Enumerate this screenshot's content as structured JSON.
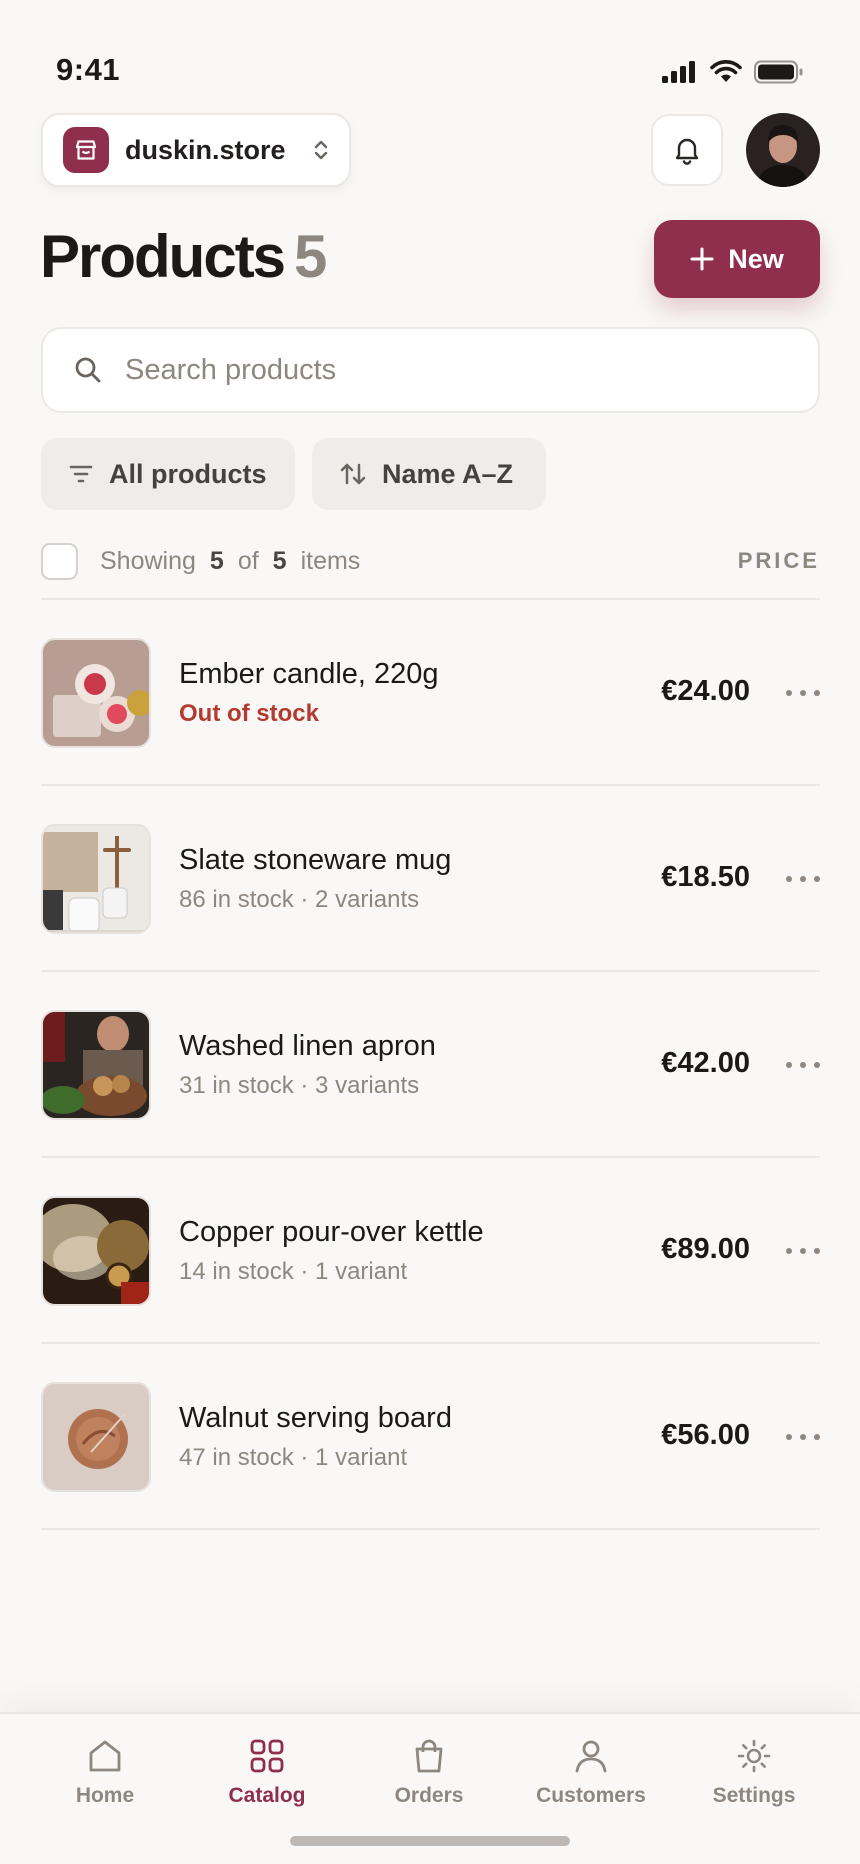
{
  "status_bar": {
    "time": "9:41"
  },
  "store": {
    "name": "duskin.store"
  },
  "header": {
    "title": "Products",
    "count": "5",
    "new_label": "New"
  },
  "search": {
    "placeholder": "Search products"
  },
  "filters": {
    "all_label": "All products",
    "sort_label": "Name A–Z"
  },
  "list_header": {
    "showing": "Showing",
    "shown": "5",
    "of": "of",
    "total": "5",
    "items": "items",
    "price": "PRICE"
  },
  "products": [
    {
      "name": "Ember candle, 220g",
      "meta": "Out of stock",
      "price": "€24.00",
      "thumb": "candle"
    },
    {
      "name": "Slate stoneware mug",
      "meta": "86 in stock · 2 variants",
      "price": "€18.50",
      "thumb": "mug"
    },
    {
      "name": "Washed linen apron",
      "meta": "31 in stock · 3 variants",
      "price": "€42.00",
      "thumb": "apron"
    },
    {
      "name": "Copper pour-over kettle",
      "meta": "14 in stock · 1 variant",
      "price": "€89.00",
      "thumb": "kettle"
    },
    {
      "name": "Walnut serving board",
      "meta": "47 in stock · 1 variant",
      "price": "€56.00",
      "thumb": "board"
    }
  ],
  "tabs": [
    {
      "label": "Home",
      "icon": "home-icon"
    },
    {
      "label": "Catalog",
      "icon": "grid-icon",
      "active": true
    },
    {
      "label": "Orders",
      "icon": "bag-icon"
    },
    {
      "label": "Customers",
      "icon": "person-icon"
    },
    {
      "label": "Settings",
      "icon": "gear-icon"
    }
  ],
  "colors": {
    "accent": "#8f2f4d",
    "out_of_stock": "#b23a2f",
    "muted": "#8d877f",
    "background": "#faf8f7"
  }
}
